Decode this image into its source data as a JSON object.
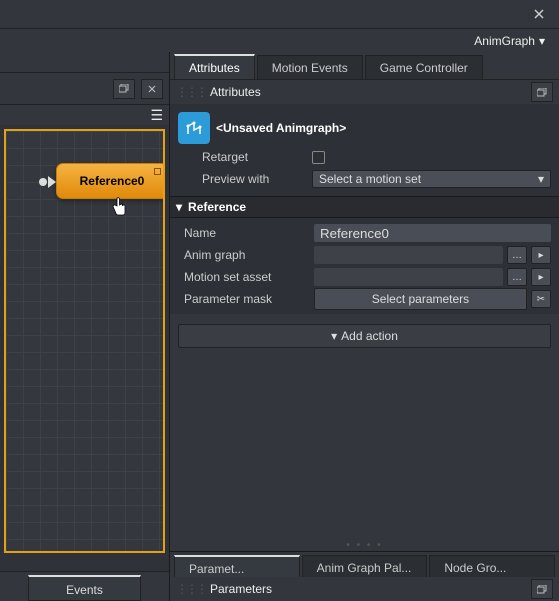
{
  "titlebar": {
    "menu_label": "AnimGraph"
  },
  "left": {
    "events_tab": "Events",
    "node_label": "Reference0"
  },
  "tabs": {
    "attributes": "Attributes",
    "motion_events": "Motion Events",
    "game_controller": "Game Controller"
  },
  "attributes_section": {
    "title": "Attributes",
    "graph_name": "<Unsaved Animgraph>",
    "retarget_label": "Retarget",
    "preview_label": "Preview with",
    "preview_value": "Select a motion set"
  },
  "reference_section": {
    "title": "Reference",
    "name_label": "Name",
    "name_value": "Reference0",
    "anim_graph_label": "Anim graph",
    "anim_graph_value": "",
    "motion_set_label": "Motion set asset",
    "motion_set_value": "",
    "param_mask_label": "Parameter mask",
    "param_mask_button": "Select parameters"
  },
  "add_action": "Add action",
  "bottom_tabs": {
    "parameters": "Paramet...",
    "anim_graph_palette": "Anim Graph Pal...",
    "node_groups": "Node Gro..."
  },
  "parameters_section": {
    "title": "Parameters"
  }
}
